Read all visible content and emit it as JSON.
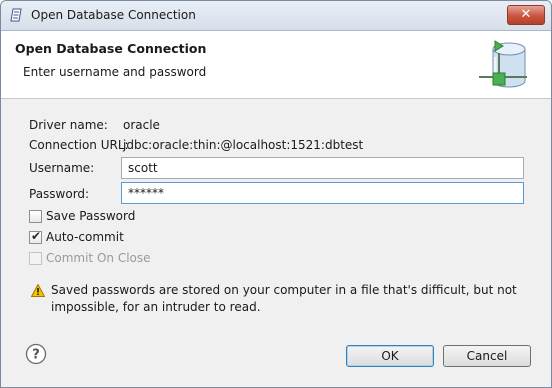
{
  "window": {
    "title": "Open Database Connection",
    "close_label": "✕"
  },
  "header": {
    "title": "Open Database Connection",
    "message": "Enter username and password"
  },
  "form": {
    "driver_label": "Driver name:",
    "driver_value": "oracle",
    "url_label": "Connection URL:",
    "url_value": "jdbc:oracle:thin:@localhost:1521:dbtest",
    "username_label": "Username:",
    "username_value": "scott",
    "password_label": "Password:",
    "password_value": "******"
  },
  "options": {
    "save_password": {
      "label": "Save Password",
      "checked": false,
      "enabled": true
    },
    "auto_commit": {
      "label": "Auto-commit",
      "checked": true,
      "enabled": true
    },
    "commit_on_close": {
      "label": "Commit On Close",
      "checked": false,
      "enabled": false
    }
  },
  "warning": {
    "text": "Saved passwords are stored on your computer in a file that's difficult, but not impossible, for an intruder to read."
  },
  "buttons": {
    "help": "?",
    "ok": "OK",
    "cancel": "Cancel"
  },
  "colors": {
    "window_bg": "#f0f0f0",
    "header_bg": "#ffffff",
    "warning_yellow": "#f5c400",
    "db_icon_blue": "#7aa6cf",
    "db_icon_green": "#4caf50"
  },
  "icons": {
    "app": "eclipse-app-icon",
    "header": "database-connection-icon",
    "warning": "warning-icon",
    "help": "help-icon"
  }
}
